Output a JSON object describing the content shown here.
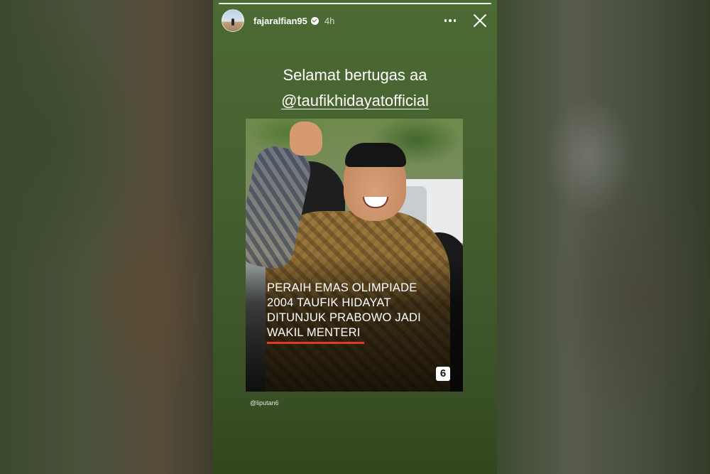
{
  "story": {
    "username": "fajaralfian95",
    "time": "4h",
    "caption_line1": "Selamat bertugas aa",
    "mention": "@taufikhidayatofficial",
    "headline": [
      "PERAIH EMAS OLIMPIADE",
      "2004 TAUFIK HIDAYAT",
      "DITUNJUK PRABOWO JADI",
      "WAKIL MENTERI"
    ],
    "logo_text": "6",
    "source": "@liputan6"
  },
  "colors": {
    "story_bg": "#46602f",
    "accent_red": "#e23a1e",
    "text": "#ffffff"
  },
  "icons": [
    "verified-badge-icon",
    "more-options-icon",
    "close-icon"
  ]
}
